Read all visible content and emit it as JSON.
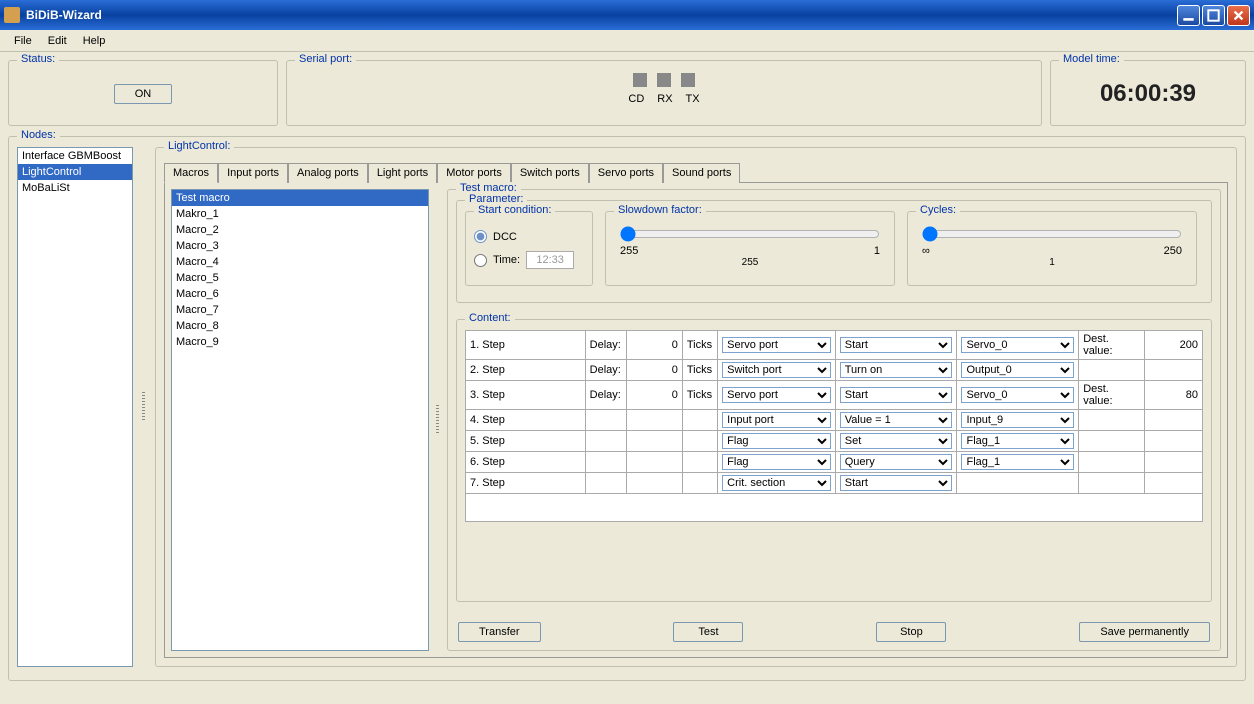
{
  "window": {
    "title": "BiDiB-Wizard"
  },
  "menu": {
    "file": "File",
    "edit": "Edit",
    "help": "Help"
  },
  "status": {
    "legend": "Status:",
    "button": "ON"
  },
  "serial": {
    "legend": "Serial port:",
    "cd": "CD",
    "rx": "RX",
    "tx": "TX"
  },
  "model": {
    "legend": "Model time:",
    "time": "06:00:39"
  },
  "nodes": {
    "legend": "Nodes:",
    "items": [
      "Interface GBMBoost",
      "LightControl",
      "MoBaLiSt"
    ],
    "selected": "LightControl"
  },
  "lightcontrol": {
    "legend": "LightControl:"
  },
  "tabs": {
    "macros": "Macros",
    "input": "Input ports",
    "analog": "Analog ports",
    "light": "Light ports",
    "motor": "Motor ports",
    "switch": "Switch ports",
    "servo": "Servo ports",
    "sound": "Sound ports"
  },
  "macros": {
    "items": [
      "Test macro",
      "Makro_1",
      "Macro_2",
      "Macro_3",
      "Macro_4",
      "Macro_5",
      "Macro_6",
      "Macro_7",
      "Macro_8",
      "Macro_9"
    ],
    "selected": "Test macro"
  },
  "macroDetail": {
    "legend": "Test macro:",
    "parameter": "Parameter:",
    "start": {
      "legend": "Start condition:",
      "dcc": "DCC",
      "time": "Time:",
      "timeValue": "12:33"
    },
    "slowdown": {
      "legend": "Slowdown factor:",
      "min": "255",
      "max": "1",
      "center": "255"
    },
    "cycles": {
      "legend": "Cycles:",
      "min": "∞",
      "max": "250",
      "center": "1"
    },
    "content": "Content:",
    "cols": {
      "delay": "Delay:",
      "ticks": "Ticks",
      "dest": "Dest. value:"
    },
    "steps": [
      {
        "n": "1. Step",
        "delay": "0",
        "port": "Servo port",
        "action": "Start",
        "target": "Servo_0",
        "dest": "200"
      },
      {
        "n": "2. Step",
        "delay": "0",
        "port": "Switch port",
        "action": "Turn on",
        "target": "Output_0",
        "dest": ""
      },
      {
        "n": "3. Step",
        "delay": "0",
        "port": "Servo port",
        "action": "Start",
        "target": "Servo_0",
        "dest": "80"
      },
      {
        "n": "4. Step",
        "delay": "",
        "port": "Input port",
        "action": "Value = 1",
        "target": "Input_9",
        "dest": ""
      },
      {
        "n": "5. Step",
        "delay": "",
        "port": "Flag",
        "action": "Set",
        "target": "Flag_1",
        "dest": ""
      },
      {
        "n": "6. Step",
        "delay": "",
        "port": "Flag",
        "action": "Query",
        "target": "Flag_1",
        "dest": ""
      },
      {
        "n": "7. Step",
        "delay": "",
        "port": "Crit. section",
        "action": "Start",
        "target": "",
        "dest": ""
      }
    ],
    "buttons": {
      "transfer": "Transfer",
      "test": "Test",
      "stop": "Stop",
      "save": "Save permanently"
    }
  }
}
